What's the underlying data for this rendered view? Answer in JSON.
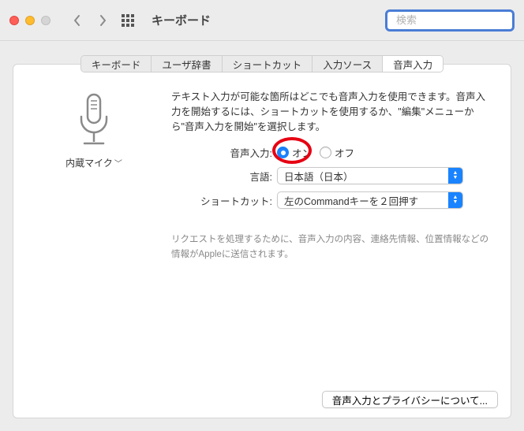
{
  "window": {
    "title": "キーボード"
  },
  "search": {
    "placeholder": "検索"
  },
  "tabs": [
    "キーボード",
    "ユーザ辞書",
    "ショートカット",
    "入力ソース",
    "音声入力"
  ],
  "active_tab_index": 4,
  "mic": {
    "label": "内蔵マイク"
  },
  "description": "テキスト入力が可能な箇所はどこでも音声入力を使用できます。音声入力を開始するには、ショートカットを使用するか、\"編集\"メニューから\"音声入力を開始\"を選択します。",
  "form": {
    "voice_input_label": "音声入力:",
    "voice_input_on": "オン",
    "voice_input_off": "オフ",
    "voice_input_selected": "on",
    "language_label": "言語:",
    "language_value": "日本語（日本）",
    "shortcut_label": "ショートカット:",
    "shortcut_value": "左のCommandキーを２回押す"
  },
  "note": "リクエストを処理するために、音声入力の内容、連絡先情報、位置情報などの情報がAppleに送信されます。",
  "privacy_button": "音声入力とプライバシーについて..."
}
